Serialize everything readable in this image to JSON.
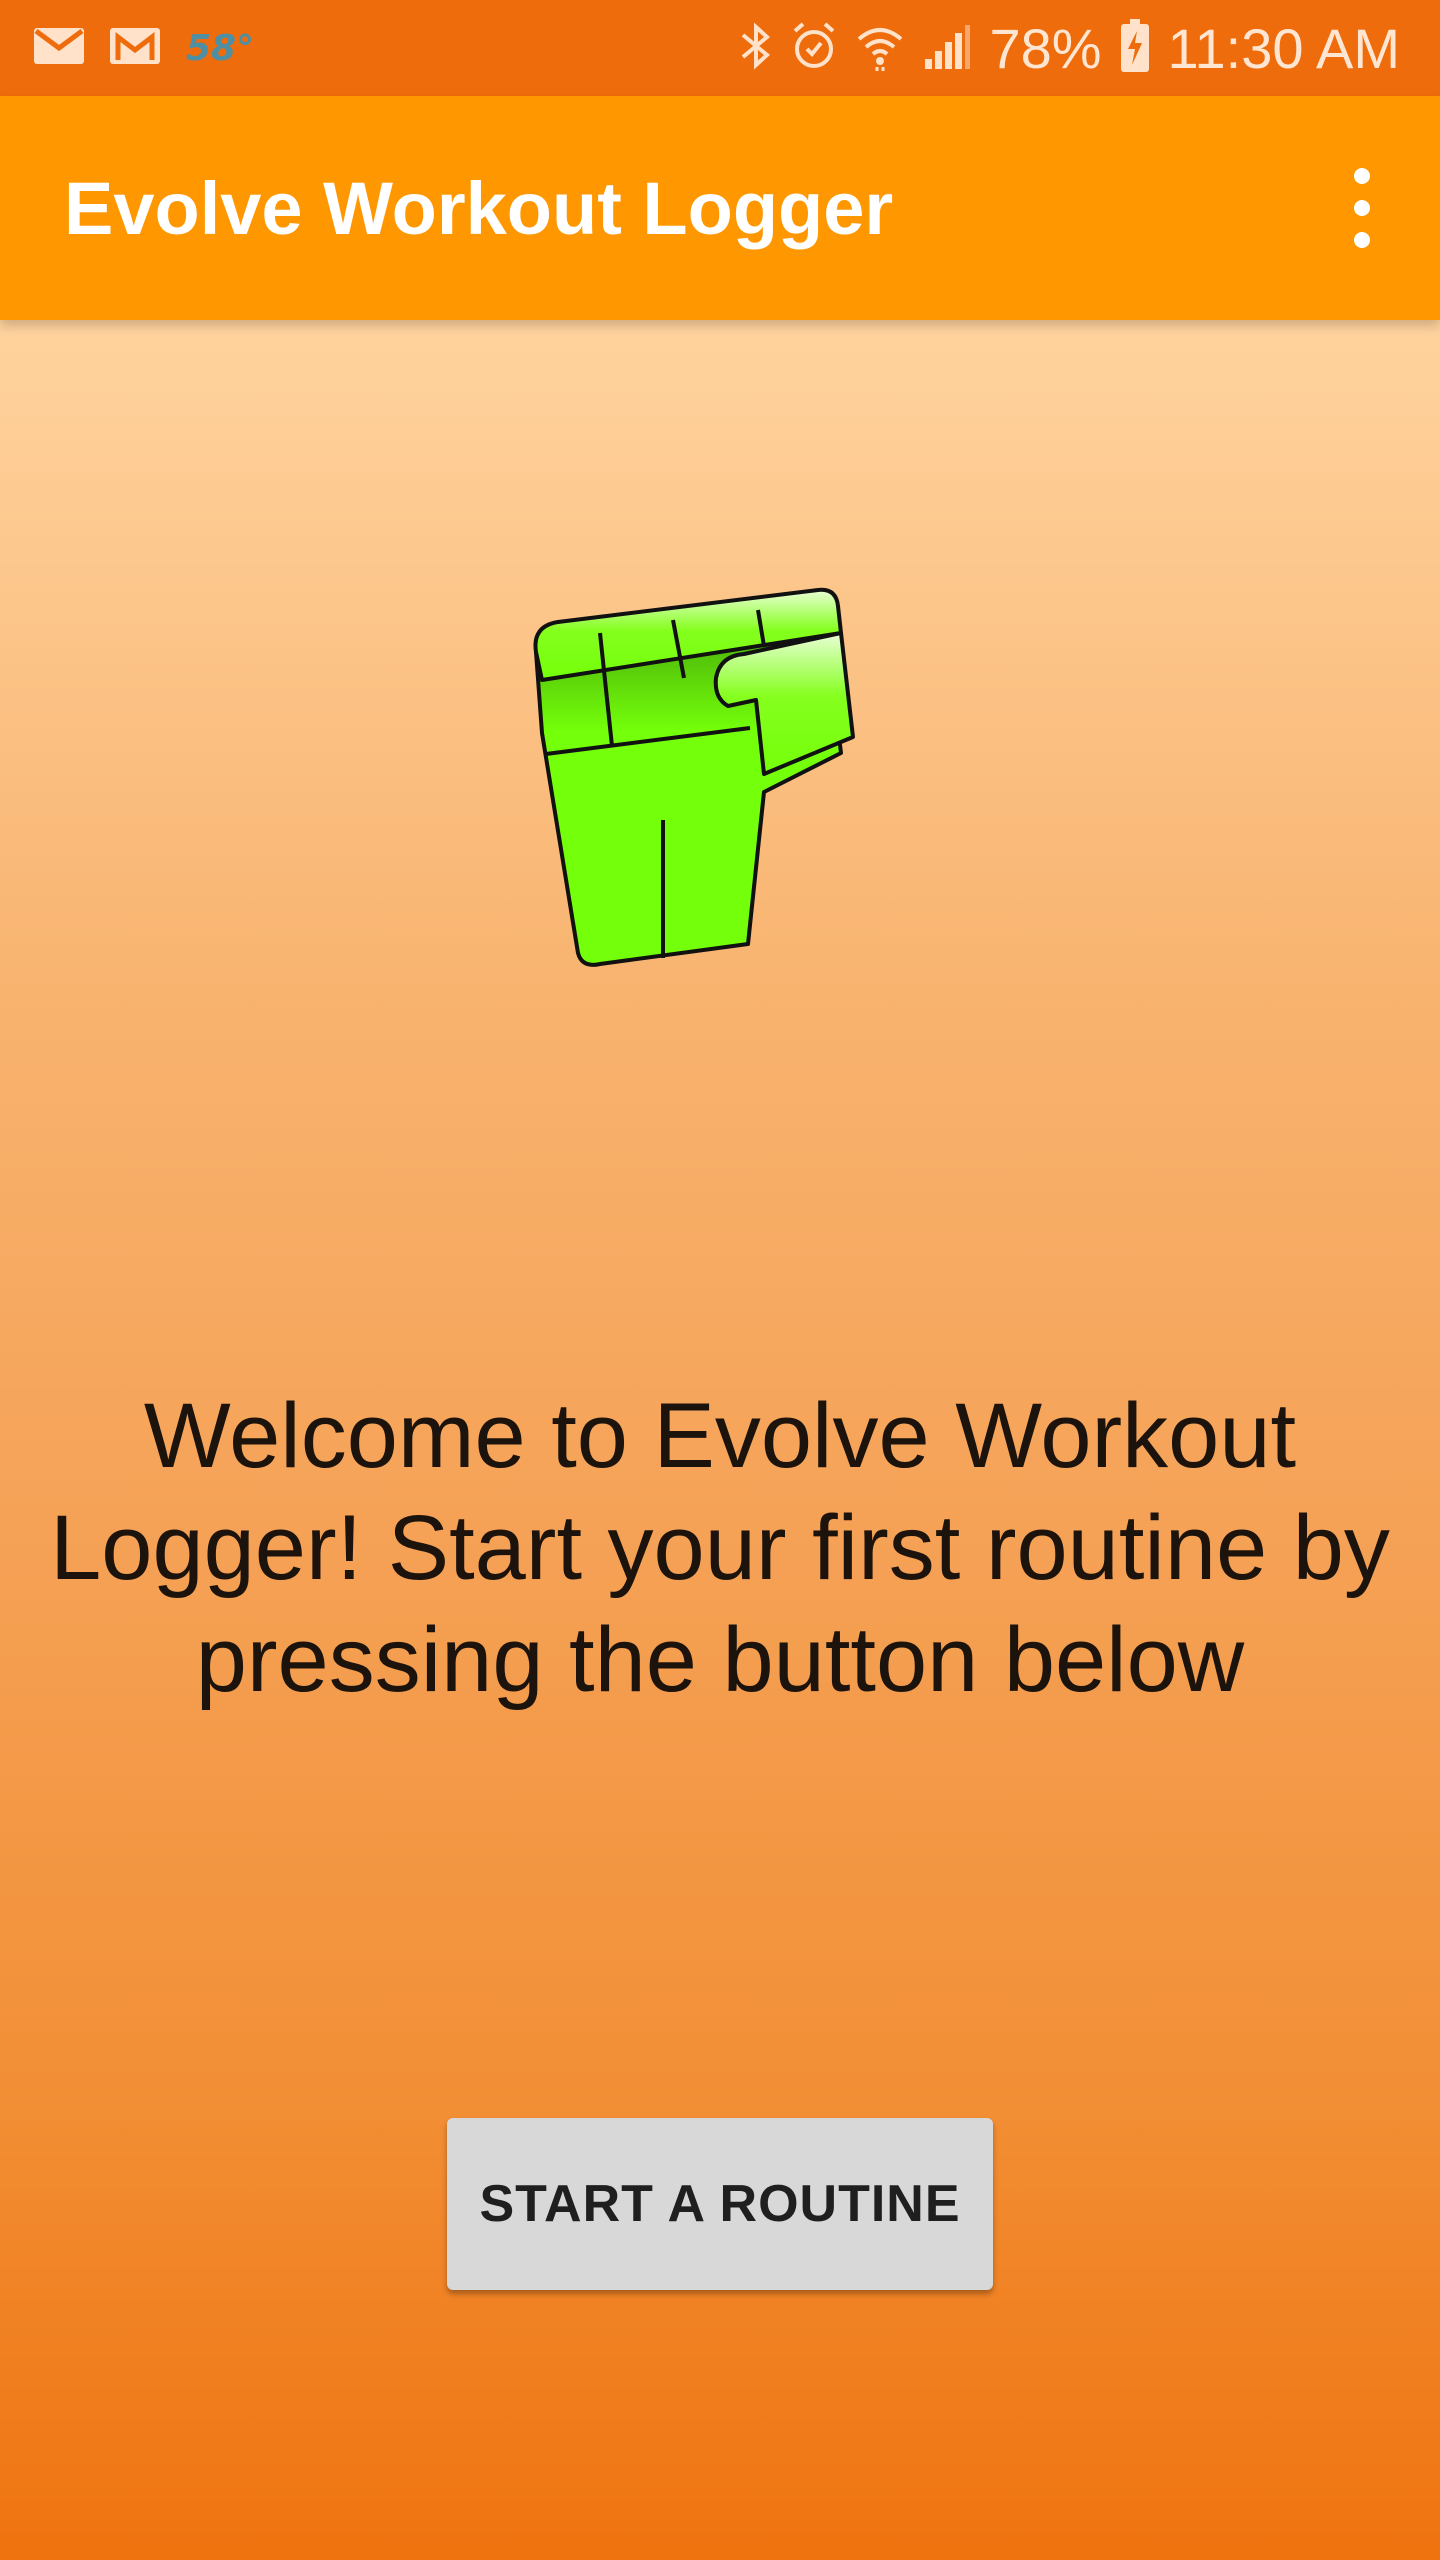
{
  "status_bar": {
    "weather": "58°",
    "battery": "78%",
    "time": "11:30 AM",
    "icons_left": [
      "email-icon",
      "gmail-icon"
    ],
    "icons_right": [
      "bluetooth-icon",
      "alarm-icon",
      "wifi-icon",
      "signal-icon",
      "battery-charging-icon"
    ]
  },
  "app_bar": {
    "title": "Evolve Workout Logger",
    "menu_icon": "more-vert-icon"
  },
  "main": {
    "logo_icon": "fist-icon",
    "welcome_text": "Welcome to Evolve Workout Logger! Start your first routine by pressing the button below",
    "start_button_label": "START A ROUTINE"
  },
  "colors": {
    "status_bar": "#ee6c0c",
    "app_bar": "#ff9700",
    "background_top": "#ffd39e",
    "background_bottom": "#ef730f",
    "logo_green": "#74ff0a",
    "button": "#d8d8d8"
  }
}
